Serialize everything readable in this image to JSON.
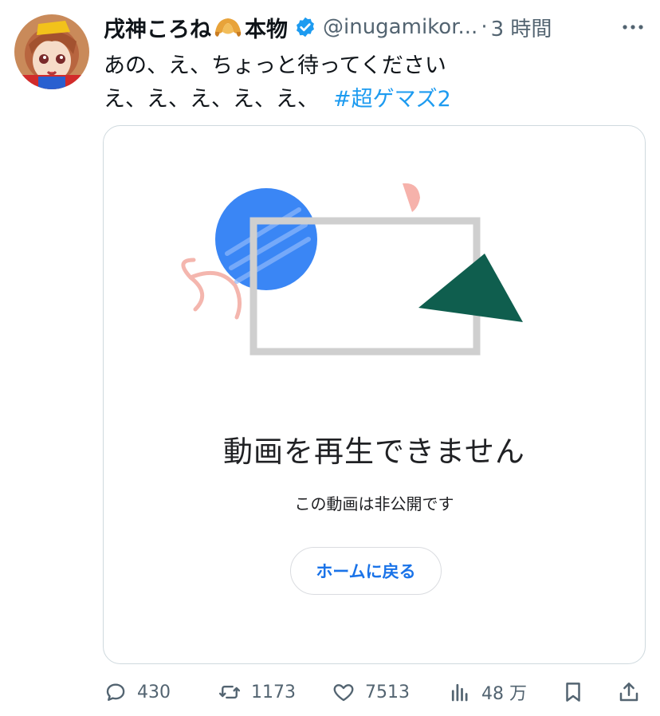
{
  "tweet": {
    "author_name_part1": "戌神ころね",
    "author_name_part2": "本物",
    "handle": "@inugamikor...",
    "separator": "·",
    "time": "3 時間",
    "text_line1": "あの、え、ちょっと待ってください",
    "text_line2": "え、え、え、え、え、",
    "hashtag": "#超ゲマズ2"
  },
  "video_error": {
    "title": "動画を再生できません",
    "subtitle": "この動画は非公開です",
    "home_button": "ホームに戻る"
  },
  "actions": {
    "reply_count": "430",
    "retweet_count": "1173",
    "like_count": "7513",
    "views_count": "48 万"
  },
  "colors": {
    "link": "#1d9bf0",
    "verified": "#1d9bf0",
    "muted": "#536471",
    "button_text": "#1a73e8"
  },
  "icons": [
    "verified-badge-icon",
    "more-options-icon",
    "croissant-emoji-icon",
    "reply-icon",
    "retweet-icon",
    "like-icon",
    "views-icon",
    "bookmark-icon",
    "share-icon"
  ]
}
